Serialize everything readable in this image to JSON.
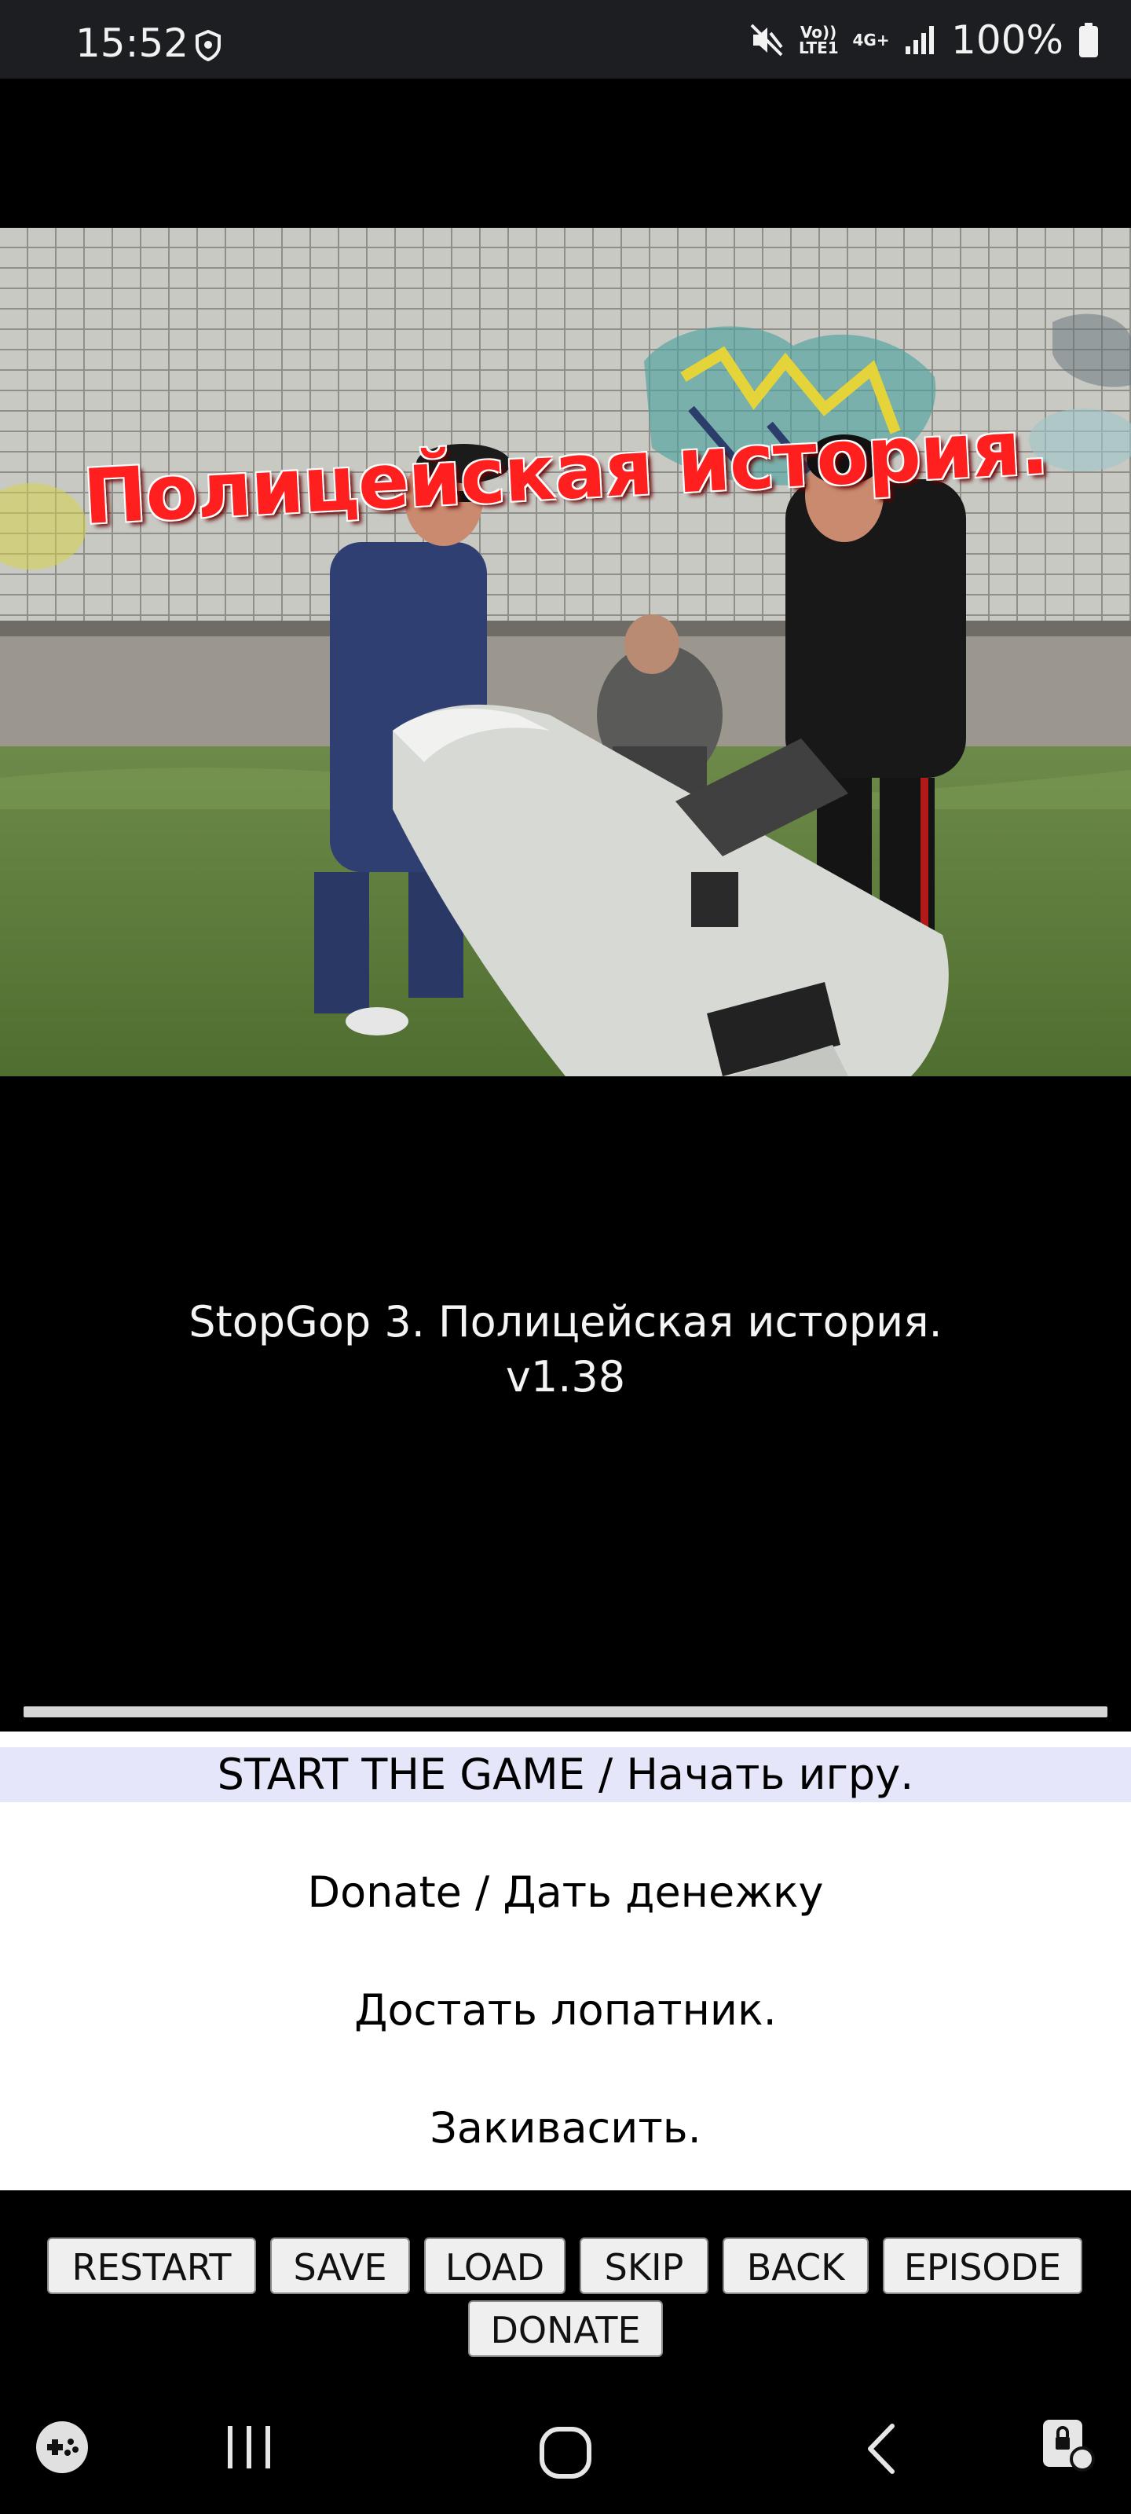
{
  "status_bar": {
    "time": "15:52",
    "volte": "Vo)) LTE1",
    "network": "4G+",
    "battery": "100%",
    "icons": [
      "shield-icon",
      "mute-icon",
      "signal-icon",
      "battery-icon"
    ]
  },
  "scene": {
    "caption": "Полицейская история.",
    "caption_color": "#ff1f1f"
  },
  "game": {
    "title": "StopGop 3. Полицейская история.",
    "version": "v1.38"
  },
  "menu": {
    "items": [
      {
        "label": "START THE GAME / Начать игру.",
        "selected": true
      },
      {
        "label": "Donate / Дать денежку",
        "selected": false
      },
      {
        "label": "Достать лопатник.",
        "selected": false
      },
      {
        "label": "Закивасить.",
        "selected": false
      }
    ],
    "selected_color": "#e6e6fa"
  },
  "buttons": {
    "restart": "RESTART",
    "save": "SAVE",
    "load": "LOAD",
    "skip": "SKIP",
    "back": "BACK",
    "episode": "EPISODE",
    "donate": "DONATE"
  },
  "nav_bar": {
    "icons": [
      "gamepad-icon",
      "recents-icon",
      "home-icon",
      "back-icon",
      "screen-lock-icon"
    ]
  }
}
